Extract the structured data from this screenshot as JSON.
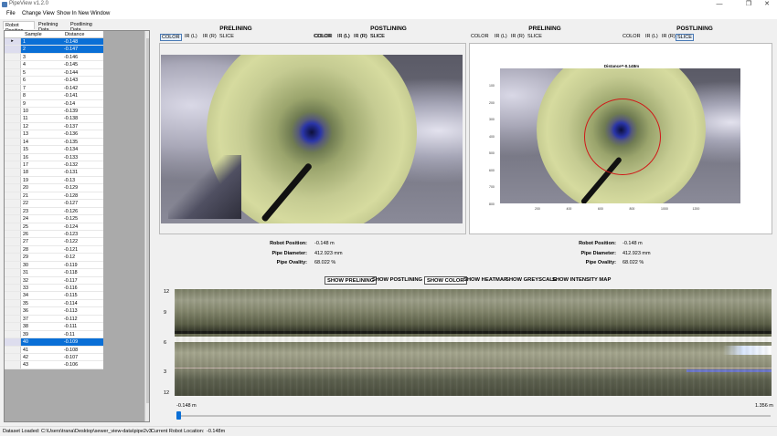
{
  "window": {
    "title": "PipeView v1.2.0",
    "min": "—",
    "max": "❐",
    "close": "✕"
  },
  "menu": [
    "File",
    "Change View",
    "Show In New Window"
  ],
  "left_tabs": [
    "Robot Position",
    "Prelining Data",
    "Postlining Data"
  ],
  "grid": {
    "columns": [
      "Sample",
      "Distance"
    ],
    "rows": [
      [
        "1",
        "-0.148"
      ],
      [
        "2",
        "-0.147"
      ],
      [
        "3",
        "-0.146"
      ],
      [
        "4",
        "-0.145"
      ],
      [
        "5",
        "-0.144"
      ],
      [
        "6",
        "-0.143"
      ],
      [
        "7",
        "-0.142"
      ],
      [
        "8",
        "-0.141"
      ],
      [
        "9",
        "-0.14"
      ],
      [
        "10",
        "-0.139"
      ],
      [
        "11",
        "-0.138"
      ],
      [
        "12",
        "-0.137"
      ],
      [
        "13",
        "-0.136"
      ],
      [
        "14",
        "-0.135"
      ],
      [
        "15",
        "-0.134"
      ],
      [
        "16",
        "-0.133"
      ],
      [
        "17",
        "-0.132"
      ],
      [
        "18",
        "-0.131"
      ],
      [
        "19",
        "-0.13"
      ],
      [
        "20",
        "-0.129"
      ],
      [
        "21",
        "-0.128"
      ],
      [
        "22",
        "-0.127"
      ],
      [
        "23",
        "-0.126"
      ],
      [
        "24",
        "-0.125"
      ],
      [
        "25",
        "-0.124"
      ],
      [
        "26",
        "-0.123"
      ],
      [
        "27",
        "-0.122"
      ],
      [
        "28",
        "-0.121"
      ],
      [
        "29",
        "-0.12"
      ],
      [
        "30",
        "-0.119"
      ],
      [
        "31",
        "-0.118"
      ],
      [
        "32",
        "-0.117"
      ],
      [
        "33",
        "-0.116"
      ],
      [
        "34",
        "-0.115"
      ],
      [
        "35",
        "-0.114"
      ],
      [
        "36",
        "-0.113"
      ],
      [
        "37",
        "-0.112"
      ],
      [
        "38",
        "-0.111"
      ],
      [
        "39",
        "-0.11"
      ],
      [
        "40",
        "-0.109"
      ],
      [
        "41",
        "-0.108"
      ],
      [
        "42",
        "-0.107"
      ],
      [
        "43",
        "-0.106"
      ]
    ],
    "highlighted_rows": [
      "1",
      "2",
      "40"
    ],
    "current_row_marker": "▸"
  },
  "left_panel": {
    "titles": [
      "PRELINING",
      "POSTLINING"
    ],
    "toolbar_pre": [
      "COLOR",
      "IR (L)",
      "IR (R)",
      "SLICE"
    ],
    "toolbar_post": [
      "COLOR",
      "IR (L)",
      "IR (R)",
      "SLICE"
    ],
    "active_pre": "COLOR",
    "stats": {
      "labels": [
        "Robot Position:",
        "Pipe Diameter:",
        "Pipe Ovality:"
      ],
      "values": [
        "-0.148 m",
        "412.923 mm",
        "68.022 %"
      ]
    }
  },
  "right_panel": {
    "titles": [
      "PRELINING",
      "POSTLINING"
    ],
    "toolbar_pre": [
      "COLOR",
      "IR (L)",
      "IR (R)",
      "SLICE"
    ],
    "toolbar_post": [
      "COLOR",
      "IR (L)",
      "IR (R)",
      "SLICE"
    ],
    "active_post": "SLICE",
    "plot_title": "Distance=-0.148m",
    "y_ticks": [
      "100",
      "200",
      "300",
      "400",
      "500",
      "600",
      "700",
      "800"
    ],
    "x_ticks": [
      "200",
      "400",
      "600",
      "800",
      "1000",
      "1200"
    ],
    "stats": {
      "labels": [
        "Robot Position:",
        "Pipe Diameter:",
        "Pipe Ovality:"
      ],
      "values": [
        "-0.148 m",
        "412.923 mm",
        "68.022 %"
      ]
    }
  },
  "view_buttons": [
    {
      "label": "SHOW PRELINING",
      "active": true
    },
    {
      "label": "SHOW POSTLINING",
      "active": false
    },
    {
      "label": "SHOW COLOR",
      "active": true
    },
    {
      "label": "SHOW HEATMAP",
      "active": false
    },
    {
      "label": "SHOW GREYSCALE",
      "active": false
    },
    {
      "label": "SHOW INTENSITY MAP",
      "active": false
    }
  ],
  "heatmap": {
    "y_ticks": [
      "12",
      "9",
      "6",
      "3",
      "12"
    ]
  },
  "slider": {
    "min_label": "-0.148 m",
    "max_label": "1.356 m",
    "value": -0.148
  },
  "status": {
    "dataset_label": "Dataset Loaded:",
    "dataset_path": "C:\\Users\\trana\\Desktop\\sewer_view-data\\pipe2v3",
    "location_label": "Current Robot Location:",
    "location_value": "-0.148m"
  },
  "colors": {
    "selection": "#0a6fd6",
    "pipe_liner": "#c9cf96",
    "ovality_circle": "#d01818"
  }
}
